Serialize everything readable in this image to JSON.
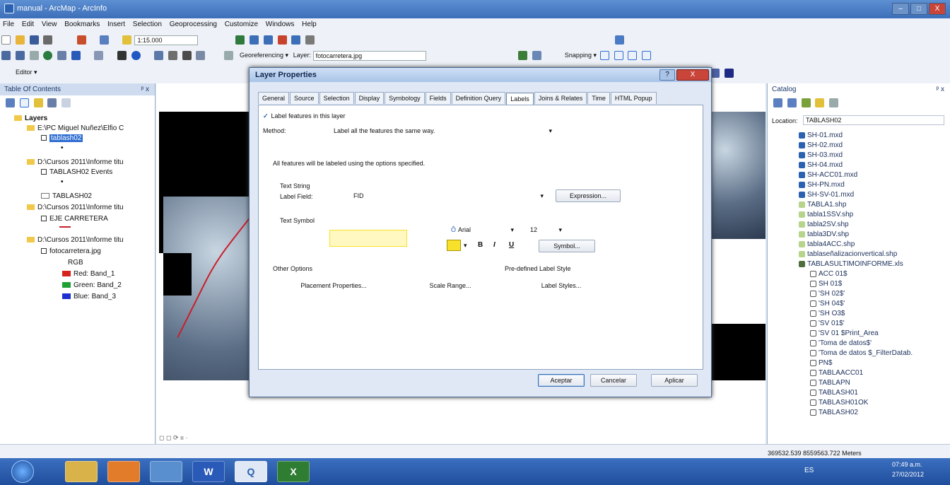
{
  "window": {
    "title": "manual - ArcMap - ArcInfo",
    "min": "–",
    "max": "□",
    "close": "X"
  },
  "menu": [
    "File",
    "Edit",
    "View",
    "Bookmarks",
    "Insert",
    "Selection",
    "Geoprocessing",
    "Customize",
    "Windows",
    "Help"
  ],
  "toolbar": {
    "scale": "1:15.000",
    "georef_label": "Georeferencing ▾",
    "layer_label": "Layer:",
    "layer_value": "fotocarretera.jpg",
    "snapping": "Snapping ▾",
    "editor": "Editor ▾"
  },
  "toc": {
    "title": "Table Of Contents",
    "pin": "ᵖ x",
    "root": "Layers",
    "items": [
      {
        "label": "E:\\PC Miguel Nuñez\\Elfio C",
        "kind": "folder"
      },
      {
        "label": "tablash02",
        "kind": "layer-selected"
      },
      {
        "label": "D:\\Cursos 2011\\Informe titu",
        "kind": "folder"
      },
      {
        "label": "TABLASH02 Events",
        "kind": "layer"
      },
      {
        "label": "TABLASH02",
        "kind": "table"
      },
      {
        "label": "D:\\Cursos 2011\\Informe titu",
        "kind": "folder"
      },
      {
        "label": "EJE CARRETERA",
        "kind": "layer"
      },
      {
        "label": "D:\\Cursos 2011\\Informe titu",
        "kind": "folder"
      },
      {
        "label": "fotocarretera.jpg",
        "kind": "layer"
      },
      {
        "label": "RGB",
        "kind": "text"
      },
      {
        "label": "Red:  Band_1",
        "kind": "band",
        "color": "#d8221e"
      },
      {
        "label": "Green: Band_2",
        "kind": "band",
        "color": "#1fa032"
      },
      {
        "label": "Blue:  Band_3",
        "kind": "band",
        "color": "#1e2fd0"
      }
    ]
  },
  "dialog": {
    "title": "Layer Properties",
    "help": "?",
    "close": "X",
    "tabs": [
      "General",
      "Source",
      "Selection",
      "Display",
      "Symbology",
      "Fields",
      "Definition Query",
      "Labels",
      "Joins & Relates",
      "Time",
      "HTML Popup"
    ],
    "active_tab": "Labels",
    "label_features": "Label features in this layer",
    "method_label": "Method:",
    "method_value": "Label all the features the same way.",
    "info": "All features will be labeled using the options specified.",
    "text_string": "Text String",
    "label_field": "Label Field:",
    "label_field_value": "FID",
    "expression": "Expression...",
    "text_symbol": "Text Symbol",
    "font": "Arial",
    "size": "12",
    "bold": "B",
    "italic": "I",
    "underline": "U",
    "symbol_btn": "Symbol...",
    "sample_color": "#f7e12a",
    "other_options": "Other Options",
    "placement": "Placement Properties...",
    "scale_range": "Scale Range...",
    "predefined": "Pre-defined Label Style",
    "label_styles": "Label Styles...",
    "ok": "Aceptar",
    "cancel": "Cancelar",
    "apply": "Aplicar"
  },
  "catalog": {
    "title": "Catalog",
    "pin": "ᵖ x",
    "location_label": "Location:",
    "location_value": "TABLASH02",
    "items": [
      {
        "label": "SH-01.mxd",
        "icon": "mxd"
      },
      {
        "label": "SH-02.mxd",
        "icon": "mxd"
      },
      {
        "label": "SH-03.mxd",
        "icon": "mxd"
      },
      {
        "label": "SH-04.mxd",
        "icon": "mxd"
      },
      {
        "label": "SH-ACC01.mxd",
        "icon": "mxd"
      },
      {
        "label": "SH-PN.mxd",
        "icon": "mxd"
      },
      {
        "label": "SH-SV-01.mxd",
        "icon": "mxd"
      },
      {
        "label": "TABLA1.shp",
        "icon": "shp"
      },
      {
        "label": "tabla1SSV.shp",
        "icon": "shp"
      },
      {
        "label": "tabla2SV.shp",
        "icon": "shp"
      },
      {
        "label": "tabla3DV.shp",
        "icon": "shp"
      },
      {
        "label": "tabla4ACC.shp",
        "icon": "shp"
      },
      {
        "label": "tablaseñalizacionvertical.shp",
        "icon": "shp"
      },
      {
        "label": "TABLASULTIMOINFORME.xls",
        "icon": "xls"
      },
      {
        "label": "ACC 01$",
        "icon": "table"
      },
      {
        "label": "SH 01$",
        "icon": "table"
      },
      {
        "label": "'SH 02$'",
        "icon": "table"
      },
      {
        "label": "'SH 04$'",
        "icon": "table"
      },
      {
        "label": "'SH O3$",
        "icon": "table"
      },
      {
        "label": "'SV 01$'",
        "icon": "table"
      },
      {
        "label": "'SV 01 $Print_Area",
        "icon": "table"
      },
      {
        "label": "'Toma de datos$'",
        "icon": "table"
      },
      {
        "label": "'Toma de datos $_FilterDatab.",
        "icon": "table"
      },
      {
        "label": "PN$",
        "icon": "table"
      },
      {
        "label": "TABLAACC01",
        "icon": "table"
      },
      {
        "label": "TABLAPN",
        "icon": "table"
      },
      {
        "label": "TABLASH01",
        "icon": "table"
      },
      {
        "label": "TABLASH01OK",
        "icon": "table"
      },
      {
        "label": "TABLASH02",
        "icon": "table"
      }
    ]
  },
  "status": {
    "coords": "369532.539  8559563.722 Meters"
  },
  "taskbar": {
    "lang": "ES",
    "time": "07:49 a.m.",
    "date": "27/02/2012"
  },
  "colors": {
    "accent": "#3c6fb8",
    "selection": "#2f6ed1",
    "band_red": "#d8221e",
    "band_green": "#1fa032",
    "band_blue": "#1e2fd0"
  }
}
